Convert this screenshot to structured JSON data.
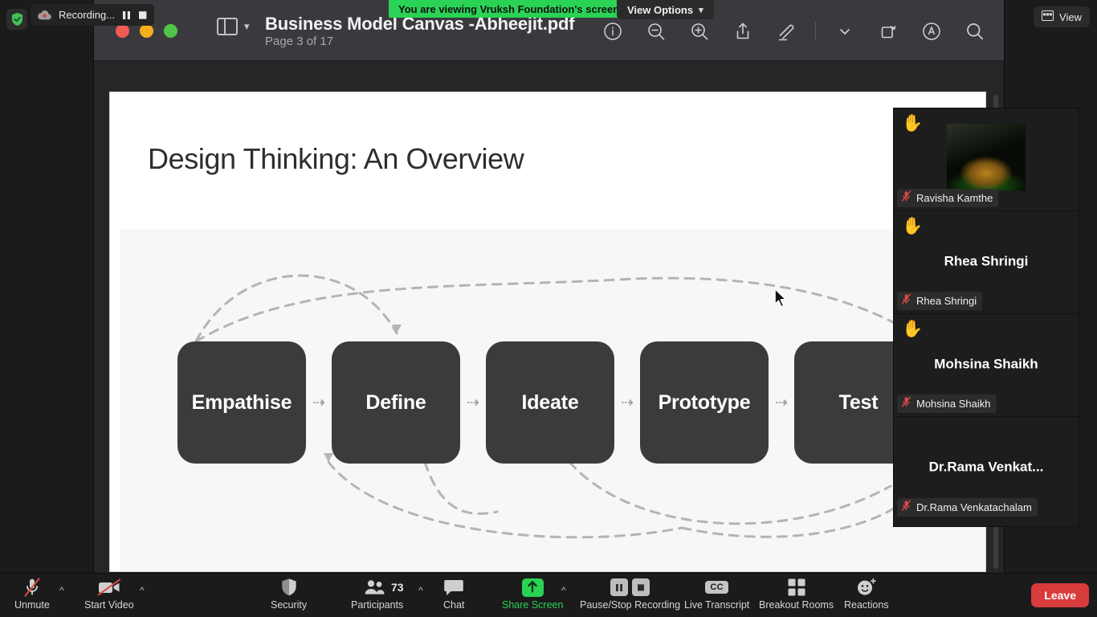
{
  "recording": {
    "shield_icon": "security-shield-icon",
    "cloud_icon": "cloud-record-icon",
    "label": "Recording...",
    "pause_icon": "pause-icon",
    "stop_icon": "stop-icon"
  },
  "share_banner": {
    "text": "You are viewing Vruksh Foundation's screen",
    "color": "#2ad355"
  },
  "view_options": {
    "label": "View Options",
    "caret": "chevron-down-icon"
  },
  "top_right": {
    "view_label": "View",
    "view_icon": "gallery-view-icon"
  },
  "pdf_window": {
    "title": "Business Model Canvas -Abheejit.pdf",
    "subtitle": "Page 3 of 17",
    "sidebar_toggle_icon": "sidebar-toggle-icon",
    "sidebar_caret": "chevron-down-icon",
    "tools": [
      {
        "name": "info-icon",
        "title": "Info"
      },
      {
        "name": "zoom-out-icon",
        "title": "Zoom Out"
      },
      {
        "name": "zoom-in-icon",
        "title": "Zoom In"
      },
      {
        "name": "share-icon",
        "title": "Share"
      },
      {
        "name": "markup-pen-icon",
        "title": "Markup"
      },
      {
        "name": "chevron-down-icon",
        "title": "More"
      },
      {
        "name": "rotate-icon",
        "title": "Rotate"
      },
      {
        "name": "annotate-icon",
        "title": "Annotate"
      },
      {
        "name": "search-icon",
        "title": "Search"
      }
    ]
  },
  "slide": {
    "title": "Design Thinking: An Overview",
    "stages": [
      {
        "label": "Empathise"
      },
      {
        "label": "Define"
      },
      {
        "label": "Ideate"
      },
      {
        "label": "Prototype"
      },
      {
        "label": "Test"
      }
    ],
    "arrow_glyph": "⇢"
  },
  "participants_panel": [
    {
      "name": "Ravisha Kamthe",
      "hand_raised": true,
      "muted": true,
      "video_on": true,
      "display_mode": "video"
    },
    {
      "name": "Rhea Shringi",
      "hand_raised": true,
      "muted": true,
      "video_on": false,
      "display_mode": "name"
    },
    {
      "name": "Mohsina Shaikh",
      "hand_raised": true,
      "muted": true,
      "video_on": false,
      "display_mode": "name"
    },
    {
      "name": "Dr.Rama  Venkat...",
      "badge_name": "Dr.Rama Venkatachalam",
      "hand_raised": false,
      "muted": true,
      "video_on": false,
      "display_mode": "name"
    }
  ],
  "toolbar": {
    "unmute": {
      "label": "Unmute",
      "icon": "mic-muted-icon",
      "has_caret": true
    },
    "start_video": {
      "label": "Start Video",
      "icon": "video-off-icon",
      "has_caret": true
    },
    "security": {
      "label": "Security",
      "icon": "shield-icon"
    },
    "participants": {
      "label": "Participants",
      "icon": "participants-icon",
      "count": "73",
      "has_caret": true
    },
    "chat": {
      "label": "Chat",
      "icon": "chat-bubble-icon"
    },
    "share_screen": {
      "label": "Share Screen",
      "icon": "share-screen-icon",
      "active": true,
      "has_caret": true,
      "color": "#2ad355"
    },
    "recording": {
      "label": "Pause/Stop Recording",
      "pause_icon": "pause-icon",
      "stop_icon": "stop-icon"
    },
    "live_transcript": {
      "label": "Live Transcript",
      "icon": "closed-caption-icon",
      "badge": "CC"
    },
    "breakout_rooms": {
      "label": "Breakout Rooms",
      "icon": "breakout-rooms-icon"
    },
    "reactions": {
      "label": "Reactions",
      "icon": "reactions-icon"
    },
    "leave": {
      "label": "Leave",
      "color": "#d83b3b"
    }
  }
}
